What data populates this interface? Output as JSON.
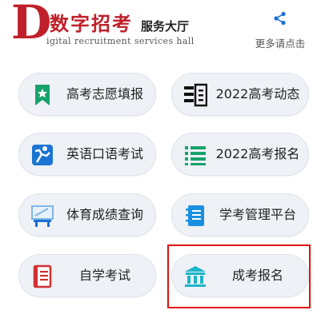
{
  "header": {
    "logo_letter": "D",
    "logo_title": "数字招考",
    "logo_subtitle": "服务大厅",
    "logo_tagline": "igital recruitment services hall",
    "share_label": "更多请点击"
  },
  "menu": [
    {
      "label": "高考志愿填报",
      "icon": "bookmark-icon"
    },
    {
      "label": "2022高考动态",
      "icon": "news-list-icon"
    },
    {
      "label": "英语口语考试",
      "icon": "english-speech-icon"
    },
    {
      "label": "2022高考报名",
      "icon": "list-icon"
    },
    {
      "label": "体育成绩查询",
      "icon": "sports-board-icon"
    },
    {
      "label": "学考管理平台",
      "icon": "notebook-icon"
    },
    {
      "label": "自学考试",
      "icon": "document-icon"
    },
    {
      "label": "成考报名",
      "icon": "institution-icon"
    }
  ],
  "colors": {
    "brand_red": "#c0202a",
    "share_blue": "#1a6fd6",
    "pill_bg": "#eef1f6",
    "highlight_border": "#e01010"
  }
}
